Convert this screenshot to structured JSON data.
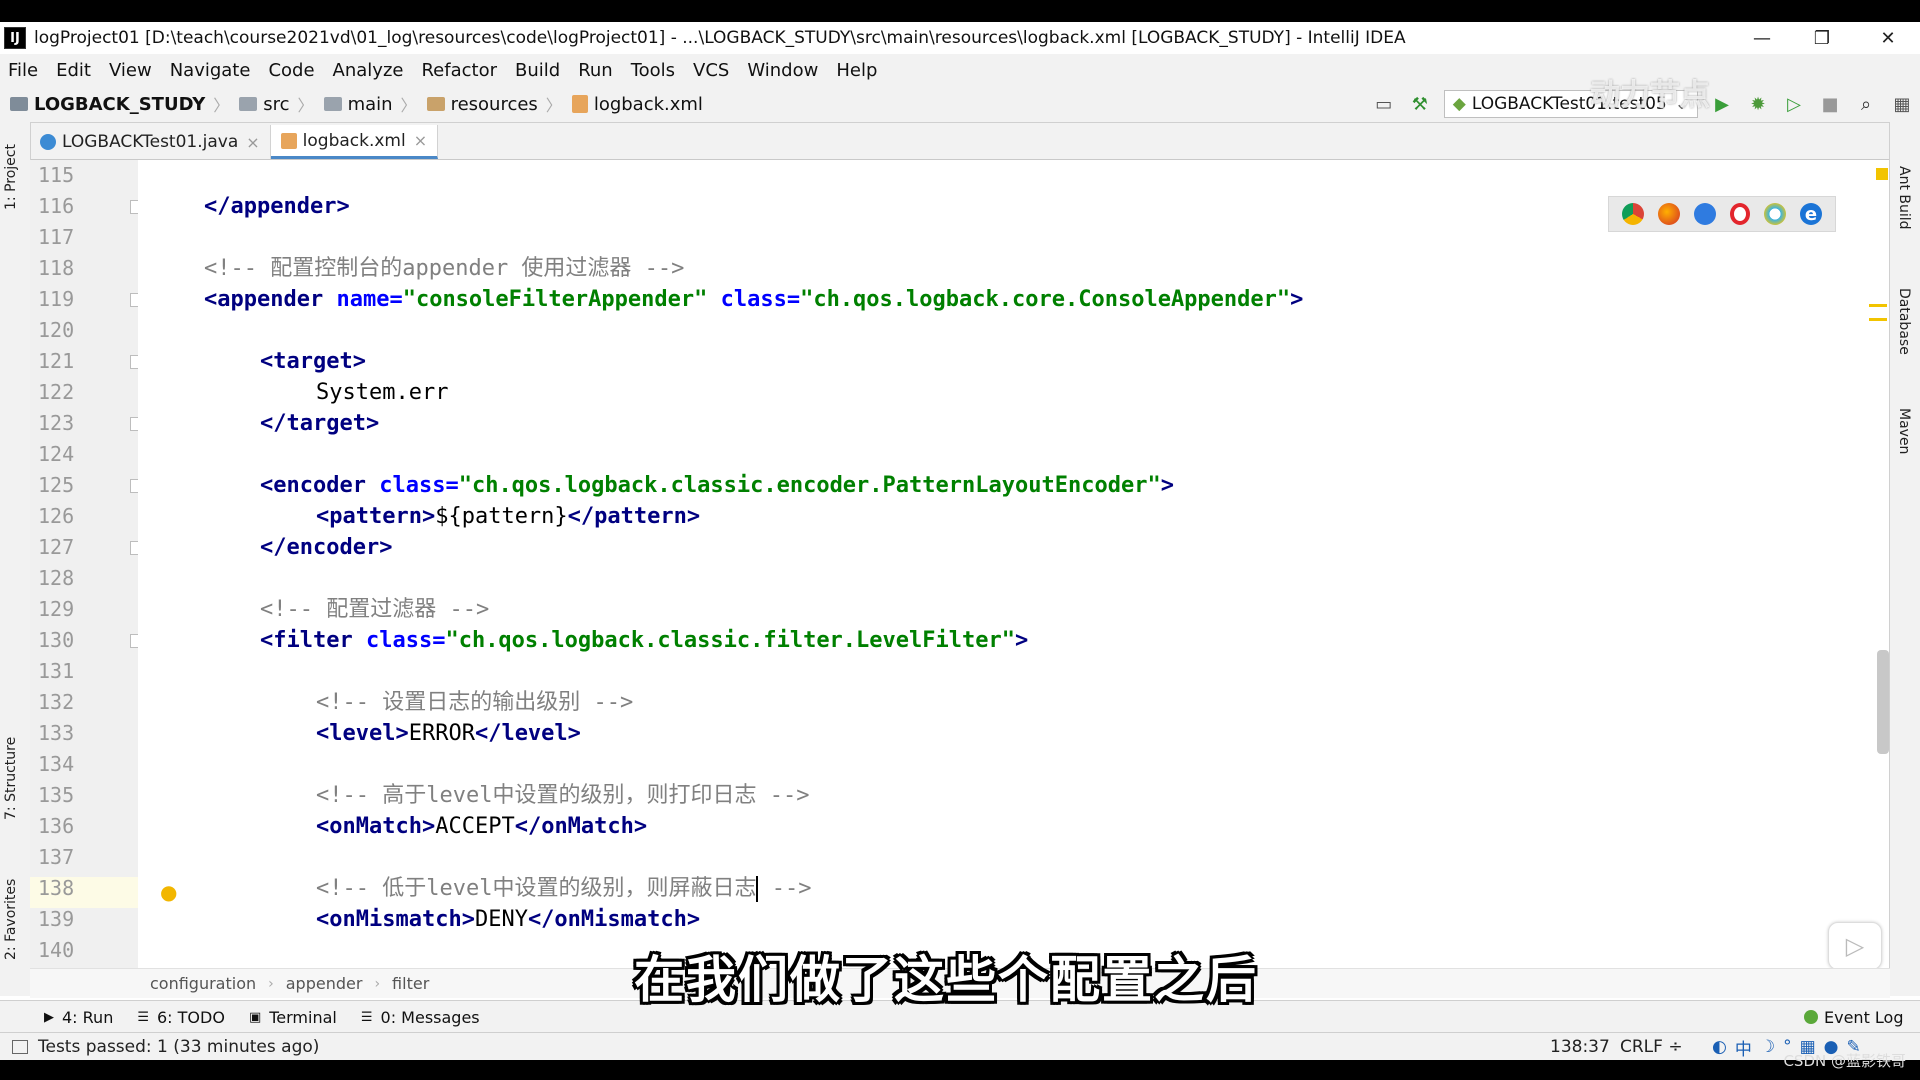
{
  "window": {
    "title": "logProject01 [D:\\teach\\course2021vd\\01_log\\resources\\code\\logProject01] - ...\\LOGBACK_STUDY\\src\\main\\resources\\logback.xml [LOGBACK_STUDY] - IntelliJ IDEA",
    "app_icon_letter": "IJ",
    "minimize": "—",
    "restore": "❐",
    "close": "✕"
  },
  "menu": [
    "File",
    "Edit",
    "View",
    "Navigate",
    "Code",
    "Analyze",
    "Refactor",
    "Build",
    "Run",
    "Tools",
    "VCS",
    "Window",
    "Help"
  ],
  "nav": {
    "project": "LOGBACK_STUDY",
    "crumbs": [
      "src",
      "main",
      "resources",
      "logback.xml"
    ],
    "run_config": "LOGBACKTest01.test05"
  },
  "tabs": [
    {
      "label": "LOGBACKTest01.java",
      "active": false
    },
    {
      "label": "logback.xml",
      "active": true
    }
  ],
  "left_tools": {
    "project": "1: Project",
    "structure": "7: Structure",
    "favorites": "2: Favorites"
  },
  "right_tools": {
    "ant": "Ant Build",
    "database": "Database",
    "maven": "Maven"
  },
  "editor": {
    "line_numbers": [
      "115",
      "116",
      "117",
      "118",
      "119",
      "120",
      "121",
      "122",
      "123",
      "124",
      "125",
      "126",
      "127",
      "128",
      "129",
      "130",
      "131",
      "132",
      "133",
      "134",
      "135",
      "136",
      "137",
      "138",
      "139",
      "140"
    ],
    "code": {
      "l116_close_appender": "</appender>",
      "l118_comment": "<!-- 配置控制台的appender 使用过滤器 -->",
      "l119_open": "<appender",
      "l119_name_attr": "name=",
      "l119_name_val": "\"consoleFilterAppender\"",
      "l119_class_attr": "class=",
      "l119_class_val": "\"ch.qos.logback.core.ConsoleAppender\"",
      "l119_end": ">",
      "l121": "<target>",
      "l122": "System.err",
      "l123": "</target>",
      "l125_open": "<encoder",
      "l125_class_attr": "class=",
      "l125_class_val": "\"ch.qos.logback.classic.encoder.PatternLayoutEncoder\"",
      "l125_end": ">",
      "l126_open": "<pattern>",
      "l126_text": "${pattern}",
      "l126_close": "</pattern>",
      "l127": "</encoder>",
      "l129_comment": "<!-- 配置过滤器 -->",
      "l130_open": "<filter",
      "l130_class_attr": "class=",
      "l130_class_val": "\"ch.qos.logback.classic.filter.LevelFilter\"",
      "l130_end": ">",
      "l132_comment": "<!-- 设置日志的输出级别 -->",
      "l133_open": "<level>",
      "l133_text": "ERROR",
      "l133_close": "</level>",
      "l135_comment": "<!-- 高于level中设置的级别，则打印日志 -->",
      "l136_open": "<onMatch>",
      "l136_text": "ACCEPT",
      "l136_close": "</onMatch>",
      "l138_comment_a": "<!-- 低于level中设置的级别，则屏蔽日志",
      "l138_comment_b": " -->",
      "l139_open": "<onMismatch>",
      "l139_text": "DENY",
      "l139_close": "</onMismatch>"
    }
  },
  "breadcrumb_footer": [
    "configuration",
    "appender",
    "filter"
  ],
  "tool_windows": [
    {
      "label": "4: Run",
      "icon": "▶"
    },
    {
      "label": "6: TODO",
      "icon": "☰"
    },
    {
      "label": "Terminal",
      "icon": "▣"
    },
    {
      "label": "0: Messages",
      "icon": "☰"
    }
  ],
  "event_log": "Event Log",
  "status": {
    "message": "Tests passed: 1 (33 minutes ago)",
    "position": "138:37",
    "line_sep": "CRLF ÷"
  },
  "overlay": {
    "subtitle": "在我们做了这些个配置之后",
    "watermark": "动力节点",
    "credit": "CSDN @蓝影铁哥"
  },
  "colors": {
    "tag": "#000080",
    "attr": "#0000ff",
    "string": "#008000",
    "comment": "#808080",
    "caret_row": "#fdfbe6"
  }
}
